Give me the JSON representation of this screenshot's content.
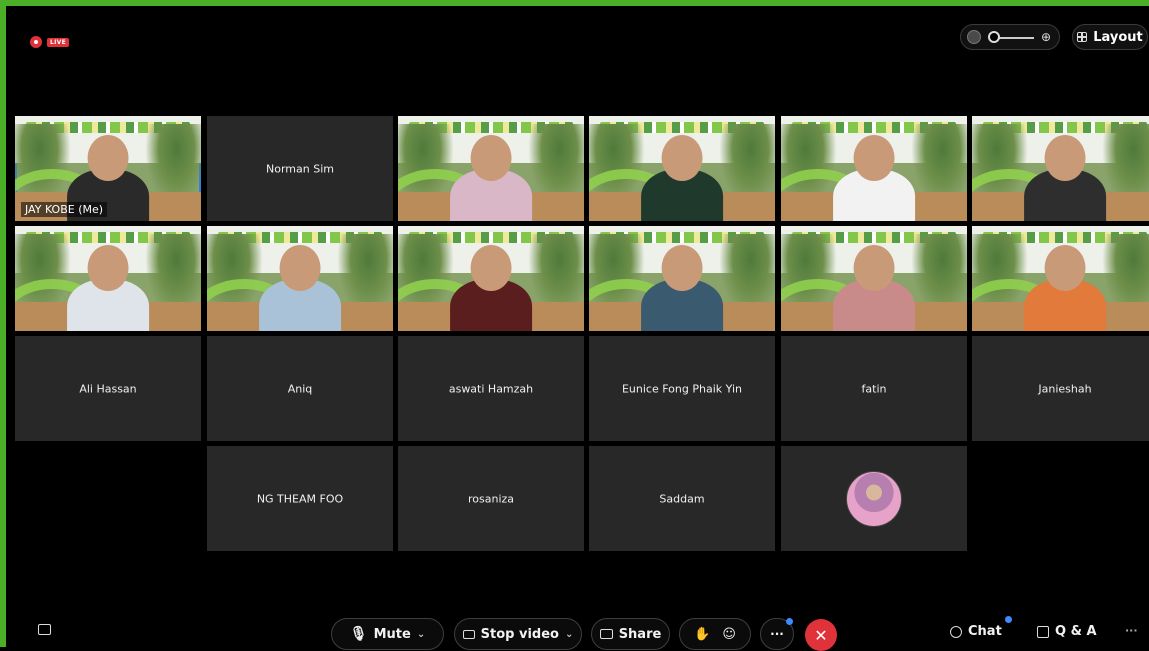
{
  "top": {
    "live_label": "LIVE",
    "layout_label": "Layout"
  },
  "participants": [
    {
      "name": "JAY KOBE (Me)",
      "video": true,
      "self": true
    },
    {
      "name": "Norman Sim",
      "video": false
    },
    {
      "name": "",
      "video": true
    },
    {
      "name": "",
      "video": true
    },
    {
      "name": "",
      "video": true
    },
    {
      "name": "",
      "video": true
    },
    {
      "name": "",
      "video": true
    },
    {
      "name": "",
      "video": true
    },
    {
      "name": "",
      "video": true
    },
    {
      "name": "",
      "video": true
    },
    {
      "name": "",
      "video": true
    },
    {
      "name": "",
      "video": true
    },
    {
      "name": "Ali Hassan",
      "video": false
    },
    {
      "name": "Aniq",
      "video": false
    },
    {
      "name": "aswati Hamzah",
      "video": false
    },
    {
      "name": "Eunice Fong Phaik Yin",
      "video": false
    },
    {
      "name": "fatin",
      "video": false
    },
    {
      "name": "Janieshah",
      "video": false
    },
    {
      "name": "NG THEAM FOO",
      "video": false
    },
    {
      "name": "rosaniza",
      "video": false
    },
    {
      "name": "Saddam",
      "video": false
    },
    {
      "name": "",
      "video": false,
      "avatar": true
    }
  ],
  "controls": {
    "mute_label": "Mute",
    "stop_video_label": "Stop video",
    "share_label": "Share",
    "chat_label": "Chat",
    "qa_label": "Q & A"
  },
  "colors": {
    "accent_border": "#4caf28",
    "end_red": "#e0323a",
    "active_blue": "#2f7fe0"
  }
}
